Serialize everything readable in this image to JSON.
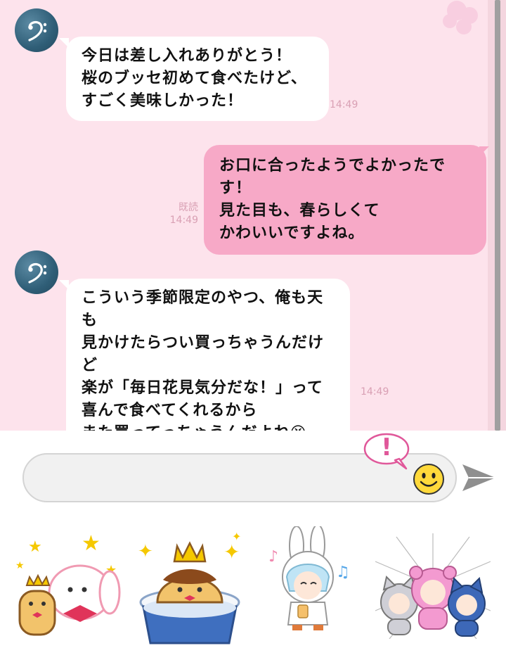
{
  "messages": [
    {
      "side": "in",
      "text": "今日は差し入れありがとう！\n桜のブッセ初めて食べたけど、\nすごく美味しかった！",
      "time": "14:49"
    },
    {
      "side": "out",
      "text": "お口に合ったようでよかったです！\n見た目も、春らしくて\nかわいいですよね。",
      "time": "14:49",
      "read": "既読"
    },
    {
      "side": "in",
      "text": "こういう季節限定のやつ、俺も天も\n見かけたらつい買っちゃうんだけど\n楽が「毎日花見気分だな！」って\n喜んで食べてくれるから\nまた買ってっちゃうんだよね😆",
      "time": "14:49"
    }
  ],
  "avatar_icon": "bass-clef-icon",
  "input": {
    "placeholder": "",
    "value": ""
  },
  "alert_mark": "!",
  "colors": {
    "chat_bg": "#fde3ec",
    "outgoing_bubble": "#f7a9c7",
    "incoming_bubble": "#ffffff",
    "timestamp": "#d9a0b4",
    "alert_pink": "#e0589a"
  },
  "stickers": [
    "bear-and-bunny-sticker",
    "crowned-pudding-sticker",
    "bunny-hood-boy-sticker",
    "animal-costume-trio-sticker"
  ]
}
